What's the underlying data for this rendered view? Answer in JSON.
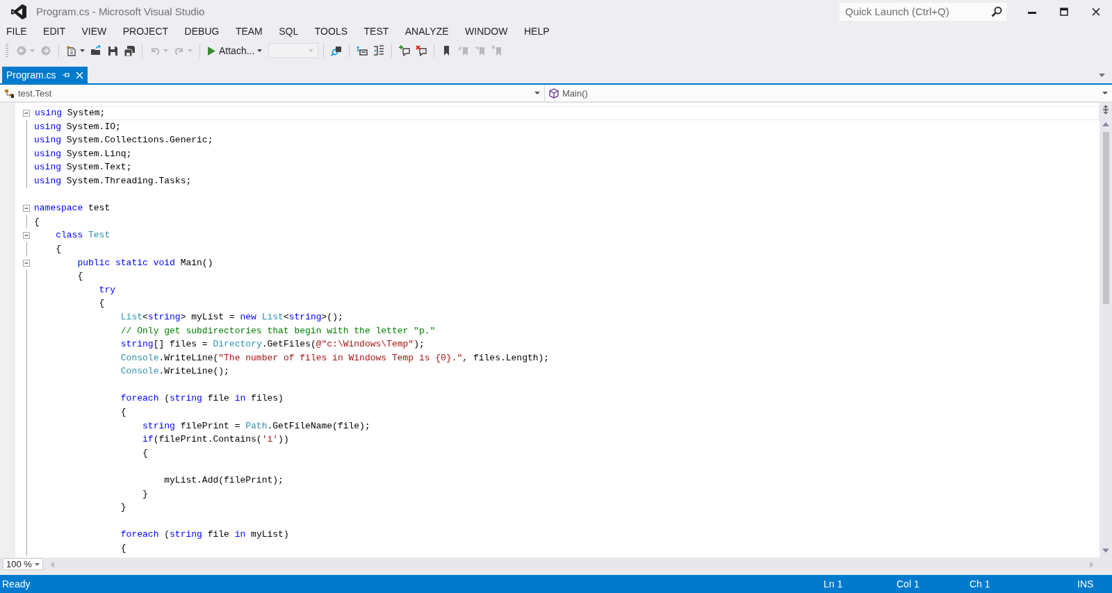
{
  "window": {
    "title": "Program.cs - Microsoft Visual Studio"
  },
  "quick_launch": {
    "placeholder": "Quick Launch (Ctrl+Q)"
  },
  "menu": [
    "FILE",
    "EDIT",
    "VIEW",
    "PROJECT",
    "DEBUG",
    "TEAM",
    "SQL",
    "TOOLS",
    "TEST",
    "ANALYZE",
    "WINDOW",
    "HELP"
  ],
  "toolbar": [
    {
      "kind": "back",
      "disabled": true
    },
    {
      "kind": "forward",
      "disabled": true
    },
    {
      "kind": "separator"
    },
    {
      "kind": "new",
      "disabled": false
    },
    {
      "kind": "open",
      "disabled": false
    },
    {
      "kind": "save",
      "disabled": false
    },
    {
      "kind": "saveall",
      "disabled": false
    },
    {
      "kind": "separator"
    },
    {
      "kind": "undo",
      "disabled": true
    },
    {
      "kind": "redo",
      "disabled": true
    },
    {
      "kind": "separator"
    },
    {
      "kind": "start",
      "label": "Attach...",
      "disabled": false
    },
    {
      "kind": "combo",
      "disabled": true
    },
    {
      "kind": "separator"
    },
    {
      "kind": "find",
      "disabled": false
    },
    {
      "kind": "separator"
    },
    {
      "kind": "outdent",
      "disabled": false
    },
    {
      "kind": "wrap",
      "disabled": false
    },
    {
      "kind": "separator"
    },
    {
      "kind": "comment",
      "disabled": false
    },
    {
      "kind": "uncomment",
      "disabled": false
    },
    {
      "kind": "separator"
    },
    {
      "kind": "bookmark",
      "disabled": false
    },
    {
      "kind": "prevbm",
      "disabled": true
    },
    {
      "kind": "nextbm",
      "disabled": true
    },
    {
      "kind": "clearbm",
      "disabled": true
    }
  ],
  "tabs": [
    {
      "label": "Program.cs",
      "selected": true
    }
  ],
  "navigation": {
    "type_scope": "test.Test",
    "member": "Main()"
  },
  "editor": {
    "lines": [
      {
        "collapsible": true,
        "current": true,
        "tokens": [
          {
            "kind": "kw",
            "text": "using"
          },
          {
            "kind": "plain",
            "text": " System;"
          }
        ]
      },
      {
        "collapsible": false,
        "current": false,
        "tokens": [
          {
            "kind": "kw",
            "text": "using"
          },
          {
            "kind": "plain",
            "text": " System.IO;"
          }
        ]
      },
      {
        "collapsible": false,
        "current": false,
        "tokens": [
          {
            "kind": "kw",
            "text": "using"
          },
          {
            "kind": "plain",
            "text": " System.Collections.Generic;"
          }
        ]
      },
      {
        "collapsible": false,
        "current": false,
        "tokens": [
          {
            "kind": "kw",
            "text": "using"
          },
          {
            "kind": "plain",
            "text": " System.Linq;"
          }
        ]
      },
      {
        "collapsible": false,
        "current": false,
        "tokens": [
          {
            "kind": "kw",
            "text": "using"
          },
          {
            "kind": "plain",
            "text": " System.Text;"
          }
        ]
      },
      {
        "collapsible": false,
        "current": false,
        "tokens": [
          {
            "kind": "kw",
            "text": "using"
          },
          {
            "kind": "plain",
            "text": " System.Threading.Tasks;"
          }
        ]
      },
      {
        "collapsible": false,
        "current": false
      },
      {
        "collapsible": true,
        "current": false,
        "tokens": [
          {
            "kind": "kw",
            "text": "namespace"
          },
          {
            "kind": "plain",
            "text": " test"
          }
        ]
      },
      {
        "collapsible": false,
        "current": false,
        "tokens": [
          {
            "kind": "plain",
            "text": "{"
          }
        ]
      },
      {
        "collapsible": true,
        "current": false,
        "tokens": [
          {
            "kind": "kw",
            "text": "    class "
          },
          {
            "kind": "type",
            "text": "Test"
          }
        ]
      },
      {
        "collapsible": false,
        "current": false,
        "tokens": [
          {
            "kind": "plain",
            "text": "    {"
          }
        ]
      },
      {
        "collapsible": true,
        "current": false,
        "tokens": [
          {
            "kind": "kw",
            "text": "        public static void"
          },
          {
            "kind": "plain",
            "text": " Main()"
          }
        ]
      },
      {
        "collapsible": false,
        "current": false,
        "tokens": [
          {
            "kind": "plain",
            "text": "        {"
          }
        ]
      },
      {
        "collapsible": false,
        "current": false,
        "tokens": [
          {
            "kind": "kw",
            "text": "            try"
          }
        ]
      },
      {
        "collapsible": false,
        "current": false,
        "tokens": [
          {
            "kind": "plain",
            "text": "            {"
          }
        ]
      },
      {
        "collapsible": false,
        "current": false,
        "tokens": [
          {
            "kind": "type",
            "text": "                List"
          },
          {
            "kind": "plain",
            "text": "<"
          },
          {
            "kind": "kw",
            "text": "string"
          },
          {
            "kind": "plain",
            "text": "> myList = "
          },
          {
            "kind": "kw",
            "text": "new "
          },
          {
            "kind": "type",
            "text": "List"
          },
          {
            "kind": "plain",
            "text": "<"
          },
          {
            "kind": "kw",
            "text": "string"
          },
          {
            "kind": "plain",
            "text": ">();"
          }
        ]
      },
      {
        "collapsible": false,
        "current": false,
        "tokens": [
          {
            "kind": "comment",
            "text": "                // Only get subdirectories that begin with the letter \"p.\""
          }
        ]
      },
      {
        "collapsible": false,
        "current": false,
        "tokens": [
          {
            "kind": "kw",
            "text": "                string"
          },
          {
            "kind": "plain",
            "text": "[] files = "
          },
          {
            "kind": "type",
            "text": "Directory"
          },
          {
            "kind": "plain",
            "text": ".GetFiles("
          },
          {
            "kind": "str",
            "text": "@\"c:\\Windows\\Temp\""
          },
          {
            "kind": "plain",
            "text": ");"
          }
        ]
      },
      {
        "collapsible": false,
        "current": false,
        "tokens": [
          {
            "kind": "type",
            "text": "                Console"
          },
          {
            "kind": "plain",
            "text": ".WriteLine("
          },
          {
            "kind": "str",
            "text": "\"The number of files in Windows Temp is {0}.\""
          },
          {
            "kind": "plain",
            "text": ", files.Length);"
          }
        ]
      },
      {
        "collapsible": false,
        "current": false,
        "tokens": [
          {
            "kind": "type",
            "text": "                Console"
          },
          {
            "kind": "plain",
            "text": ".WriteLine();"
          }
        ]
      },
      {
        "collapsible": false,
        "current": false
      },
      {
        "collapsible": false,
        "current": false,
        "tokens": [
          {
            "kind": "kw",
            "text": "                foreach"
          },
          {
            "kind": "plain",
            "text": " ("
          },
          {
            "kind": "kw",
            "text": "string"
          },
          {
            "kind": "plain",
            "text": " file "
          },
          {
            "kind": "kw",
            "text": "in"
          },
          {
            "kind": "plain",
            "text": " files)"
          }
        ]
      },
      {
        "collapsible": false,
        "current": false,
        "tokens": [
          {
            "kind": "plain",
            "text": "                {"
          }
        ]
      },
      {
        "collapsible": false,
        "current": false,
        "tokens": [
          {
            "kind": "kw",
            "text": "                    string"
          },
          {
            "kind": "plain",
            "text": " filePrint = "
          },
          {
            "kind": "type",
            "text": "Path"
          },
          {
            "kind": "plain",
            "text": ".GetFileName(file);"
          }
        ]
      },
      {
        "collapsible": false,
        "current": false,
        "tokens": [
          {
            "kind": "kw",
            "text": "                    if"
          },
          {
            "kind": "plain",
            "text": "(filePrint.Contains("
          },
          {
            "kind": "str",
            "text": "'i'"
          },
          {
            "kind": "plain",
            "text": "))"
          }
        ]
      },
      {
        "collapsible": false,
        "current": false,
        "tokens": [
          {
            "kind": "plain",
            "text": "                    {"
          }
        ]
      },
      {
        "collapsible": false,
        "current": false
      },
      {
        "collapsible": false,
        "current": false,
        "tokens": [
          {
            "kind": "plain",
            "text": "                        myList.Add(filePrint);"
          }
        ]
      },
      {
        "collapsible": false,
        "current": false,
        "tokens": [
          {
            "kind": "plain",
            "text": "                    }"
          }
        ]
      },
      {
        "collapsible": false,
        "current": false,
        "tokens": [
          {
            "kind": "plain",
            "text": "                }"
          }
        ]
      },
      {
        "collapsible": false,
        "current": false
      },
      {
        "collapsible": false,
        "current": false,
        "tokens": [
          {
            "kind": "kw",
            "text": "                foreach"
          },
          {
            "kind": "plain",
            "text": " ("
          },
          {
            "kind": "kw",
            "text": "string"
          },
          {
            "kind": "plain",
            "text": " file "
          },
          {
            "kind": "kw",
            "text": "in"
          },
          {
            "kind": "plain",
            "text": " myList)"
          }
        ]
      },
      {
        "collapsible": false,
        "current": false,
        "tokens": [
          {
            "kind": "plain",
            "text": "                {"
          }
        ]
      }
    ]
  },
  "zoom": "100 %",
  "status_bar": {
    "message": "Ready",
    "line": "Ln 1",
    "column": "Col 1",
    "char": "Ch 1",
    "mode": "INS"
  }
}
